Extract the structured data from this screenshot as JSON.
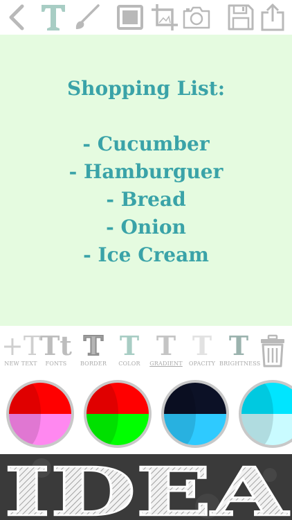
{
  "toolbar": {
    "icons": [
      "back-icon",
      "text-icon",
      "brush-icon",
      "border-frame-icon",
      "crop-icon",
      "camera-icon",
      "save-icon",
      "share-icon"
    ],
    "active_color": "#a8cdc4",
    "inactive_color": "#b9b9b9"
  },
  "canvas": {
    "background": "#e5fbe0",
    "text_color": "#3aa3a8",
    "title": "Shopping List:",
    "items": [
      "- Cucumber",
      "- Hamburguer",
      "- Bread",
      "- Onion",
      "- Ice Cream"
    ]
  },
  "tools": [
    {
      "glyph": "+T",
      "label": "NEW TEXT",
      "selected": false
    },
    {
      "glyph": "Tt",
      "label": "FONTS",
      "selected": false
    },
    {
      "glyph": "T",
      "label": "BORDER",
      "selected": false
    },
    {
      "glyph": "T",
      "label": "COLOR",
      "selected": false
    },
    {
      "glyph": "T",
      "label": "GRADIENT",
      "selected": true
    },
    {
      "glyph": "T",
      "label": "OPACITY",
      "selected": false
    },
    {
      "glyph": "T",
      "label": "BRIGHTNESS",
      "selected": false
    }
  ],
  "swatches": [
    {
      "top": "#ff0000",
      "bottom": "#ff88f0"
    },
    {
      "top": "#ff0000",
      "bottom": "#00ff00"
    },
    {
      "top": "#0c1126",
      "bottom": "#2ecaff"
    },
    {
      "top": "#00e5ff",
      "bottom": "#c9fbff"
    }
  ],
  "banner": {
    "text": "IDEA"
  }
}
